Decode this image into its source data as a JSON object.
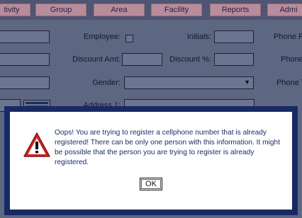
{
  "nav": {
    "items": [
      "tivity",
      "Group",
      "Area",
      "Facility",
      "Reports",
      "Admi"
    ]
  },
  "form": {
    "employee_label": "Employee:",
    "initials_label": "Initials:",
    "phone1_label": "Phone F",
    "discount_amt_label": "Discount Amt:",
    "discount_pct_label": "Discount %:",
    "phone2_label": "Phone",
    "gender_label": "Gender:",
    "phone3_label": "Phone T",
    "address1_label": "Address 1:"
  },
  "dialog": {
    "message": "Oops! You are trying to register a cellphone number that is already registered! There can be only one person with this information. It might be possible that the person you are trying to register is already registered.",
    "ok_label": "OK"
  },
  "colors": {
    "overlay_background": "#5d6782",
    "nav_button": "#b98c9b",
    "dialog_frame": "#182a63",
    "warning_red": "#d42420"
  }
}
